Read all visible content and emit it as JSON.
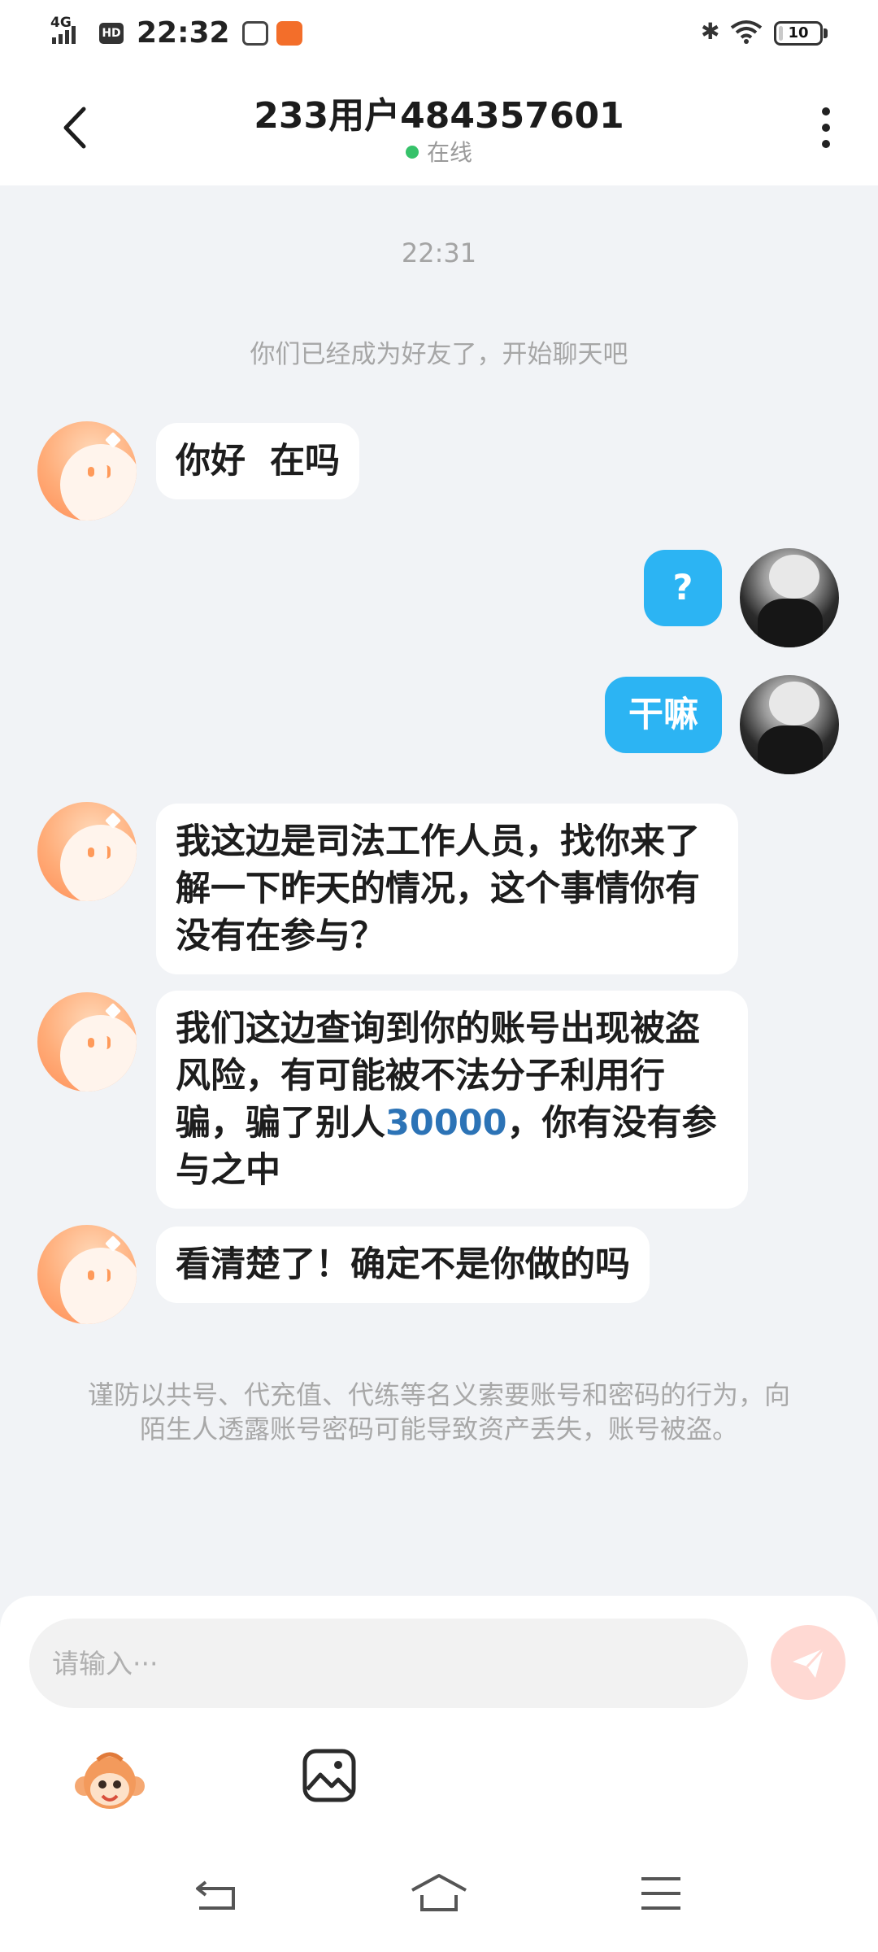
{
  "status_bar": {
    "network": "4G",
    "hd": "HD",
    "time": "22:32",
    "battery": "10",
    "battery_level": 0.1,
    "icons": [
      "signal-icon",
      "hd-icon",
      "app-icon",
      "app-icon",
      "bluetooth-icon",
      "wifi-icon",
      "battery-icon"
    ]
  },
  "header": {
    "title": "233用户484357601",
    "status": "在线",
    "status_color": "#36c26a",
    "back_icon": "chevron-left-icon",
    "more_icon": "more-vertical-icon"
  },
  "chat": {
    "time": "22:31",
    "system_note": "你们已经成为好友了，开始聊天吧",
    "messages": [
      {
        "side": "left",
        "text": "你好  在吗"
      },
      {
        "side": "right",
        "text": "?"
      },
      {
        "side": "right",
        "text": "干嘛"
      },
      {
        "side": "left",
        "text": "我这边是司法工作人员，找你来了解一下昨天的情况，这个事情你有没有在参与？"
      },
      {
        "side": "left",
        "text_before": "我们这边查询到你的账号出现被盗风险，有可能被不法分子利用行骗，骗了别人",
        "text_highlight": "30000",
        "text_after": "，你有没有参与之中"
      },
      {
        "side": "left",
        "text": "看清楚了！确定不是你做的吗"
      }
    ],
    "warning": "谨防以共号、代充值、代练等名义索要账号和密码的行为，向陌生人透露账号密码可能导致资产丢失，账号被盗。"
  },
  "input": {
    "placeholder": "请输入···",
    "value": "",
    "send_icon": "send-icon",
    "emoji_icon": "monkey-emoji-icon",
    "image_icon": "image-icon"
  },
  "colors": {
    "accent_blue": "#2cb4f3",
    "highlight": "#2c73b6",
    "send_button": "#ffd9d3",
    "background": "#f1f3f6"
  },
  "nav": {
    "icons": [
      "back-nav-icon",
      "home-nav-icon",
      "menu-nav-icon"
    ]
  }
}
